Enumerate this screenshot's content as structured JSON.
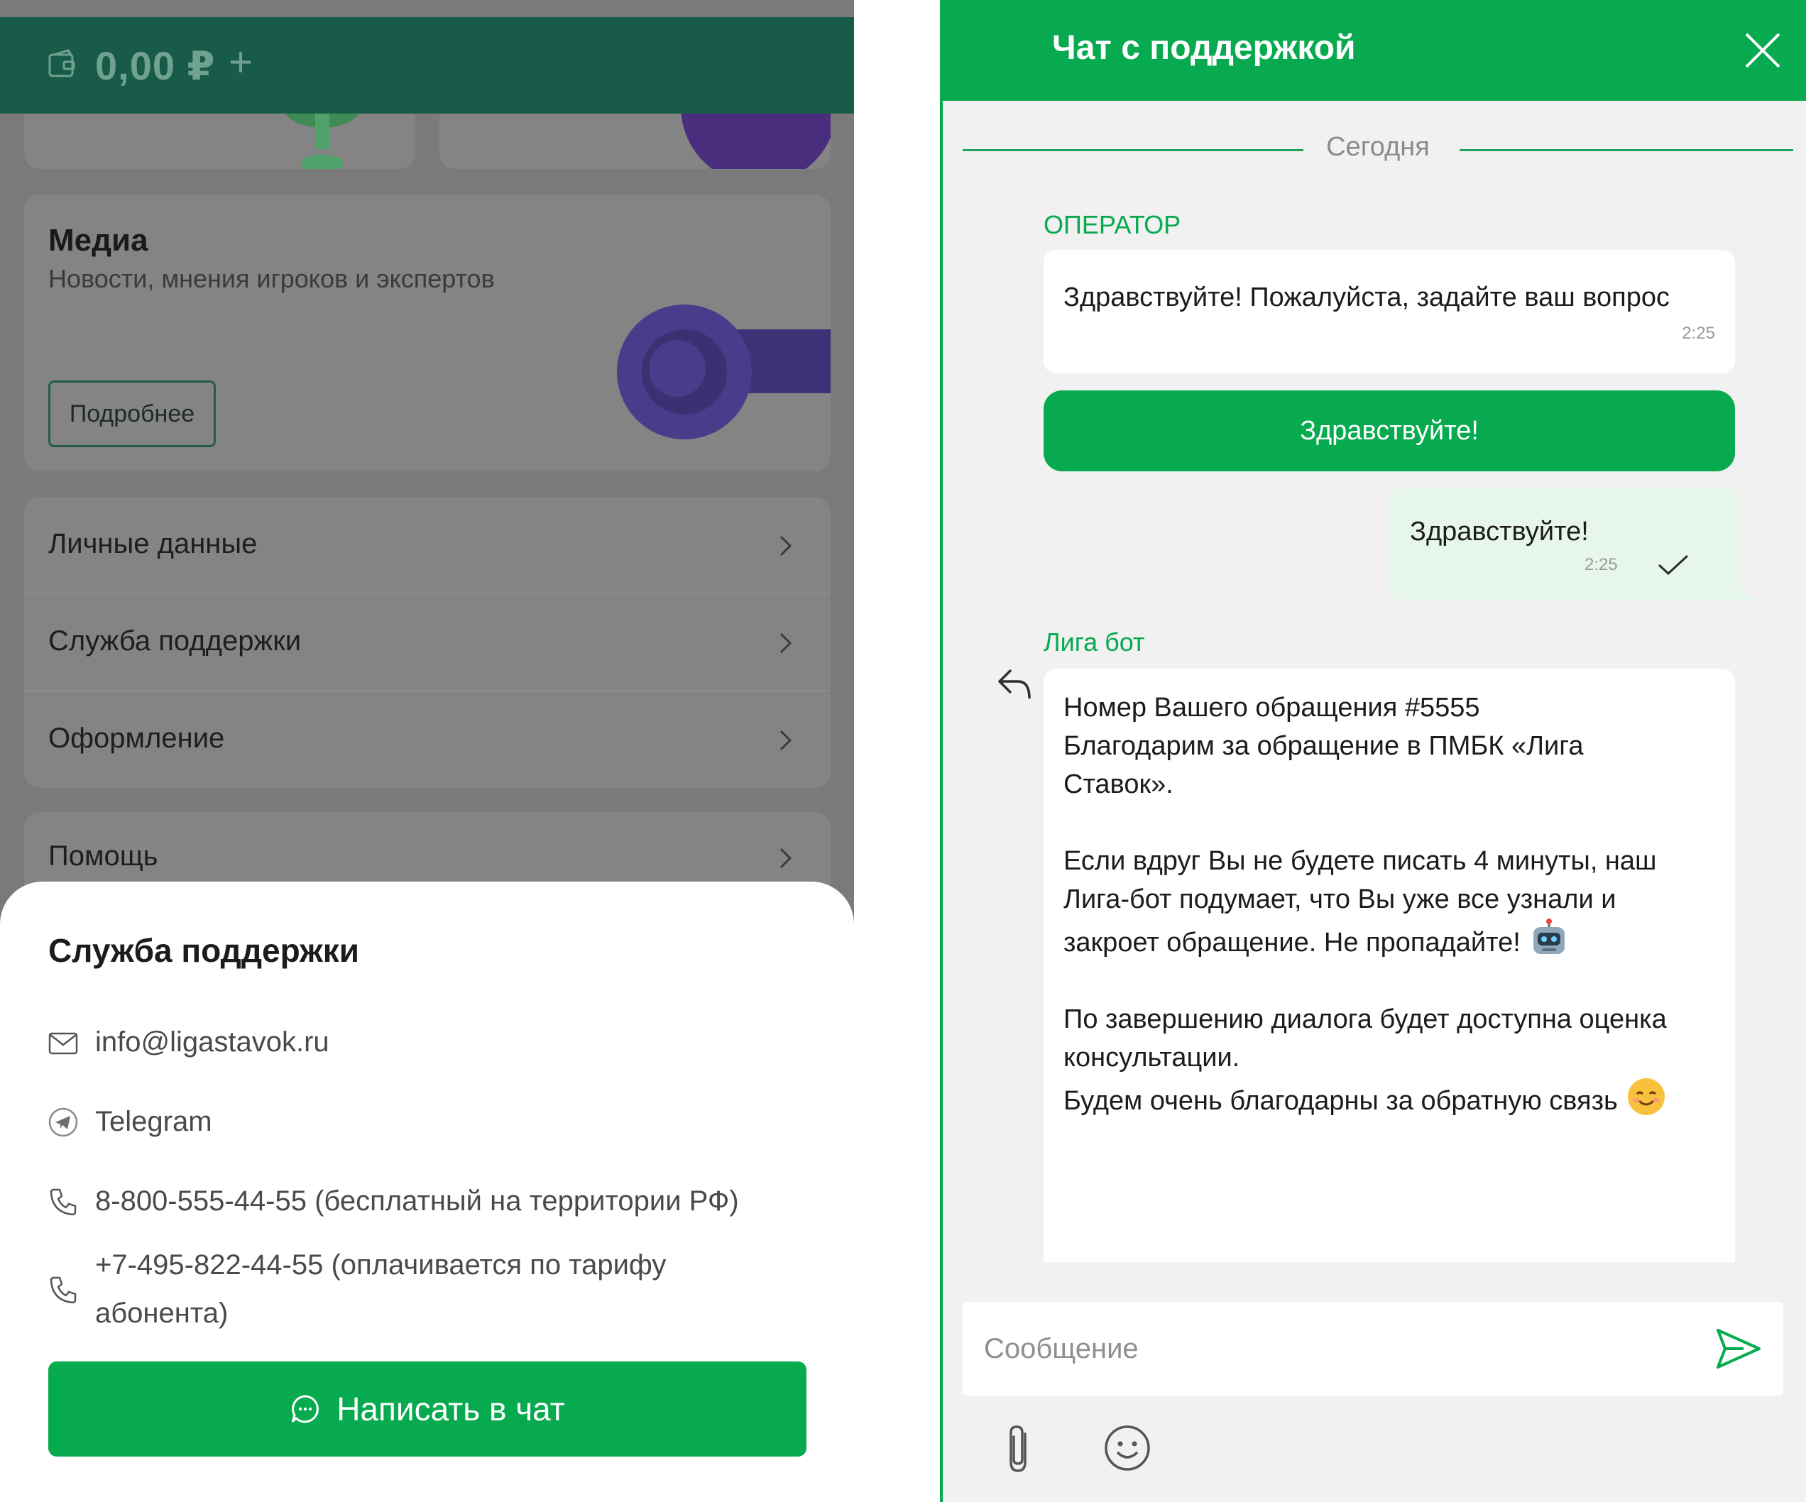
{
  "left": {
    "topbar": {
      "balance": "0,00 ₽",
      "add": "+"
    },
    "media": {
      "title": "Медиа",
      "subtitle": "Новости, мнения игроков и экспертов",
      "more_label": "Подробнее"
    },
    "menu": [
      {
        "label": "Личные данные"
      },
      {
        "label": "Служба поддержки"
      },
      {
        "label": "Оформление"
      },
      {
        "label": "Помощь"
      }
    ],
    "sheet": {
      "title": "Служба поддержки",
      "email": "info@ligastavok.ru",
      "telegram": "Telegram",
      "phone1": "8-800-555-44-55 (бесплатный на территории РФ)",
      "phone2_line1": "+7-495-822-44-55 (оплачивается по тарифу",
      "phone2_line2": "абонента)",
      "chat_button": "Написать в чат"
    },
    "colors": {
      "topbar": "#175b48",
      "accent": "#07aa4f",
      "overlay": "#7a7a7a"
    }
  },
  "chat": {
    "title": "Чат с поддержкой",
    "date_separator": "Сегодня",
    "operator_label": "ОПЕРАТОР",
    "operator_message": {
      "text": "Здравствуйте! Пожалуйста, задайте ваш вопрос",
      "time": "2:25"
    },
    "quick_reply": "Здравствуйте!",
    "user_message": {
      "text": "Здравствуйте!",
      "time": "2:25",
      "status": "sent"
    },
    "bot_label": "Лига бот",
    "bot_message": {
      "p1_line1": "Номер Вашего обращения #5555",
      "p1_line2": "Благодарим за обращение в ПМБК «Лига",
      "p1_line3": "Ставок».",
      "p2_line1": "Если вдруг Вы не будете писать 4 минуты, наш",
      "p2_line2": "Лига-бот подумает, что Вы уже все узнали и",
      "p2_line3": "закроет обращение. Не пропадайте!",
      "p3_line1": "По завершению диалога будет доступна оценка",
      "p3_line2": "консультации.",
      "p3_line3": "Будем очень благодарны за обратную связь"
    },
    "composer": {
      "placeholder": "Сообщение"
    },
    "icons": [
      "close-icon",
      "reply-icon",
      "robot-emoji",
      "smiling-emoji",
      "send-icon",
      "paperclip-icon",
      "emoji-icon",
      "checkmark-icon"
    ],
    "colors": {
      "header": "#07aa4f",
      "background": "#f1f1f1",
      "outgoing_bubble": "#e7f6ea"
    }
  }
}
